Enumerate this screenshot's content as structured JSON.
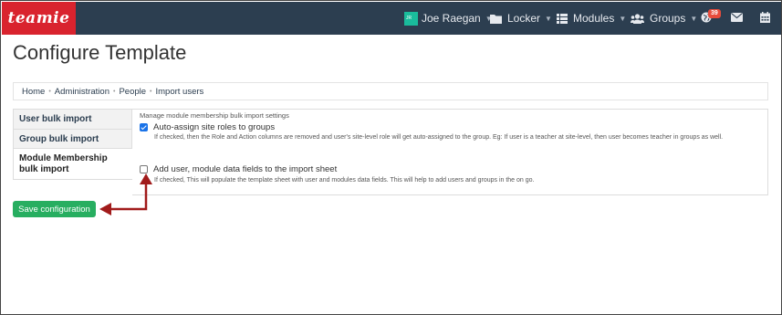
{
  "app": {
    "logo_text": "teamie",
    "brand_color": "#d9232e",
    "navbar_color": "#2c3e50"
  },
  "navbar": {
    "user_name": "Joe Raegan",
    "items": [
      {
        "label": "Locker",
        "icon": "folder-icon"
      },
      {
        "label": "Modules",
        "icon": "list-icon"
      },
      {
        "label": "Groups",
        "icon": "users-icon"
      }
    ],
    "notifications_count": "39",
    "icons": [
      "globe-icon",
      "envelope-icon",
      "calendar-icon"
    ]
  },
  "page": {
    "title": "Configure Template"
  },
  "breadcrumb": [
    "Home",
    "Administration",
    "People",
    "Import users"
  ],
  "tabs": [
    {
      "label": "User bulk import",
      "active": false
    },
    {
      "label": "Group bulk import",
      "active": false
    },
    {
      "label": "Module Membership bulk import",
      "active": true
    }
  ],
  "settings": {
    "legend": "Manage module membership bulk import settings",
    "options": [
      {
        "label": "Auto-assign site roles to groups",
        "checked": true,
        "help": "If checked, then the Role and Action columns are removed and user's site-level role will get auto-assigned to the group. Eg: If user is a teacher at site-level, then user becomes teacher in groups as well."
      },
      {
        "label": "Add user, module data fields to the import sheet",
        "checked": false,
        "help": "If checked, This will populate the template sheet with user and modules data fields. This will help to add users and groups in the on go."
      }
    ]
  },
  "actions": {
    "save_label": "Save configuration",
    "save_color": "#27ae60"
  },
  "annotation_color": "#a11b1b"
}
